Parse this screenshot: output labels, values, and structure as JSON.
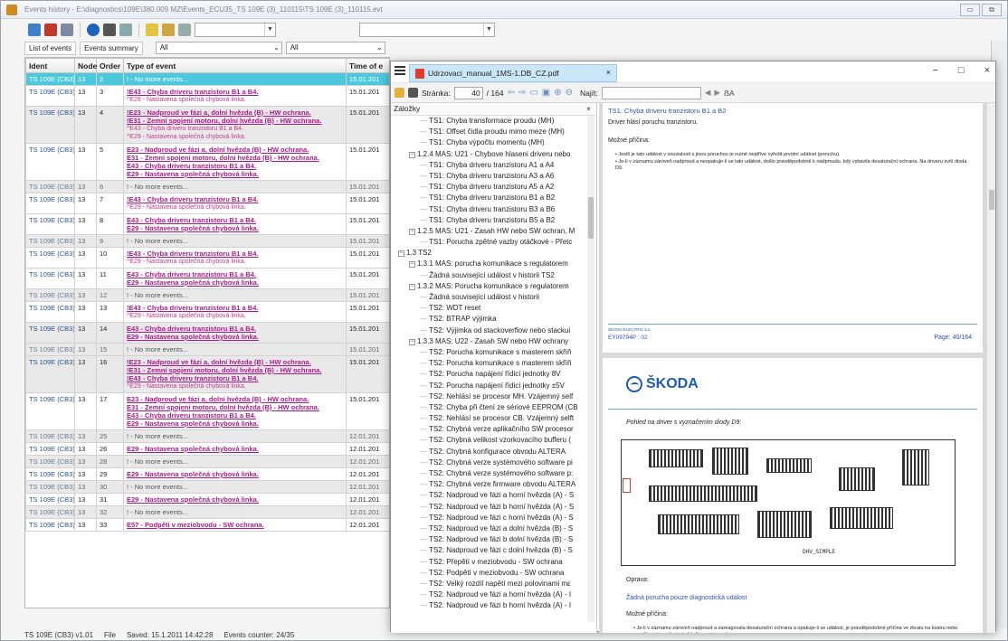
{
  "window": {
    "title": "Events history - E:\\diagnostics\\109E\\380.009 MZ\\Events_ECU35_TS 109E (3)_110115\\TS 109E (3)_110115.evt",
    "controls": [
      "▭",
      "⧉"
    ]
  },
  "toolbar": {
    "filter_value": "",
    "search_value": ""
  },
  "tabs": [
    "List of events",
    "Events summary"
  ],
  "filters": [
    "All",
    "All"
  ],
  "table": {
    "headers": [
      "Ident",
      "Node",
      "Order",
      "Type of event",
      "Time of e"
    ],
    "rows": [
      {
        "style": "sel",
        "ident": "TS 109E (CB3)",
        "node": "13",
        "order": "2",
        "lines": [
          "! - No more events..."
        ],
        "time": "15.01.201"
      },
      {
        "style": "pink",
        "ident": "TS 109E (CB3)",
        "node": "13",
        "order": "3",
        "lines": [
          "!E43 - Chyba driveru tranzistoru B1 a B4.",
          "^E29 - Nastavena společná chybová linka."
        ],
        "time": "15.01.201"
      },
      {
        "style": "mixed",
        "ident": "TS 109E (CB3)",
        "node": "13",
        "order": "4",
        "lines": [
          "!E23 - Nadproud ve fázi a, dolní hvězda (B) - HW ochrana.",
          "!E31 - Zemní spojení motoru, dolní hvězda (B) - HW ochrana.",
          "^E43 - Chyba driveru tranzistoru B1 a B4.",
          "^E29 - Nastavena společná chybová linka."
        ],
        "time": "15.01.201"
      },
      {
        "style": "pink",
        "ident": "TS 109E (CB3)",
        "node": "13",
        "order": "5",
        "lines": [
          "E23 - Nadproud ve fázi a, dolní hvězda (B) - HW ochrana.",
          "E31 - Zemní spojení motoru, dolní hvězda (B) - HW ochrana.",
          "E43 - Chyba driveru tranzistoru B1 a B4.",
          "E29 - Nastavena společná chybová linka."
        ],
        "time": "15.01.201"
      },
      {
        "style": "gray",
        "ident": "TS 109E (CB3)",
        "node": "13",
        "order": "6",
        "lines": [
          "! - No more events..."
        ],
        "time": "15.01.201"
      },
      {
        "style": "pink",
        "ident": "TS 109E (CB3)",
        "node": "13",
        "order": "7",
        "lines": [
          "!E43 - Chyba driveru tranzistoru B1 a B4.",
          "^E29 - Nastavena společná chybová linka."
        ],
        "time": "15.01.201"
      },
      {
        "style": "pink",
        "ident": "TS 109E (CB3)",
        "node": "13",
        "order": "8",
        "lines": [
          "E43 - Chyba driveru tranzistoru B1 a B4.",
          "E29 - Nastavena společná chybová linka."
        ],
        "time": "15.01.201"
      },
      {
        "style": "gray",
        "ident": "TS 109E (CB3)",
        "node": "13",
        "order": "9",
        "lines": [
          "! - No more events..."
        ],
        "time": "15.01.201"
      },
      {
        "style": "pink",
        "ident": "TS 109E (CB3)",
        "node": "13",
        "order": "10",
        "lines": [
          "!E43 - Chyba driveru tranzistoru B1 a B4.",
          "^E29 - Nastavena společná chybová linka."
        ],
        "time": "15.01.201"
      },
      {
        "style": "pink",
        "ident": "TS 109E (CB3)",
        "node": "13",
        "order": "11",
        "lines": [
          "E43 - Chyba driveru tranzistoru B1 a B4.",
          "E29 - Nastavena společná chybová linka."
        ],
        "time": "15.01.201"
      },
      {
        "style": "gray",
        "ident": "TS 109E (CB3)",
        "node": "13",
        "order": "12",
        "lines": [
          "! - No more events..."
        ],
        "time": "15.01.201"
      },
      {
        "style": "pink",
        "ident": "TS 109E (CB3)",
        "node": "13",
        "order": "13",
        "lines": [
          "!E43 - Chyba driveru tranzistoru B1 a B4.",
          "^E29 - Nastavena společná chybová linka."
        ],
        "time": "15.01.201"
      },
      {
        "style": "mixed",
        "ident": "TS 109E (CB3)",
        "node": "13",
        "order": "14",
        "lines": [
          "E43 - Chyba driveru tranzistoru B1 a B4.",
          "E29 - Nastavena společná chybová linka."
        ],
        "time": "15.01.201"
      },
      {
        "style": "gray",
        "ident": "TS 109E (CB3)",
        "node": "13",
        "order": "15",
        "lines": [
          "! - No more events..."
        ],
        "time": "15.01.201"
      },
      {
        "style": "mixed",
        "ident": "TS 109E (CB3)",
        "node": "13",
        "order": "16",
        "lines": [
          "!E23 - Nadproud ve fázi a, dolní hvězda (B) - HW ochrana.",
          "!E31 - Zemní spojení motoru, dolní hvězda (B) - HW ochrana.",
          "!E43 - Chyba driveru tranzistoru B1 a B4.",
          "^E29 - Nastavena společná chybová linka."
        ],
        "time": "15.01.201"
      },
      {
        "style": "pink",
        "ident": "TS 109E (CB3)",
        "node": "13",
        "order": "17",
        "lines": [
          "E23 - Nadproud ve fázi a, dolní hvězda (B) - HW ochrana.",
          "E31 - Zemní spojení motoru, dolní hvězda (B) - HW ochrana.",
          "E43 - Chyba driveru tranzistoru B1 a B4.",
          "E29 - Nastavena společná chybová linka."
        ],
        "time": "15.01.201"
      },
      {
        "style": "gray",
        "ident": "TS 109E (CB3)",
        "node": "13",
        "order": "25",
        "lines": [
          "! - No more events..."
        ],
        "time": "12.01.201"
      },
      {
        "style": "pink",
        "ident": "TS 109E (CB3)",
        "node": "13",
        "order": "26",
        "lines": [
          "E29 - Nastavena společná chybová linka."
        ],
        "time": "12.01.201"
      },
      {
        "style": "gray",
        "ident": "TS 109E (CB3)",
        "node": "13",
        "order": "28",
        "lines": [
          "! - No more events..."
        ],
        "time": "12.01.201"
      },
      {
        "style": "pink",
        "ident": "TS 109E (CB3)",
        "node": "13",
        "order": "29",
        "lines": [
          "E29 - Nastavena společná chybová linka."
        ],
        "time": "12.01.201"
      },
      {
        "style": "gray",
        "ident": "TS 109E (CB3)",
        "node": "13",
        "order": "30",
        "lines": [
          "! - No more events..."
        ],
        "time": "12.01.201"
      },
      {
        "style": "pink",
        "ident": "TS 109E (CB3)",
        "node": "13",
        "order": "31",
        "lines": [
          "E29 - Nastavena společná chybová linka."
        ],
        "time": "12.01.201"
      },
      {
        "style": "gray",
        "ident": "TS 109E (CB3)",
        "node": "13",
        "order": "32",
        "lines": [
          "! - No more events..."
        ],
        "time": "12.01.201"
      },
      {
        "style": "pink",
        "ident": "TS 109E (CB3)",
        "node": "13",
        "order": "33",
        "lines": [
          "E57 - Podpětí v meziobvodu - SW ochrana."
        ],
        "time": "12.01.201"
      }
    ]
  },
  "status": {
    "device": "TS 109E (CB3) v1.01",
    "file": "File",
    "saved": "Saved: 15.1.2011 14:42:28",
    "counter": "Events counter: 24/35"
  },
  "pdf": {
    "tab_title": "Udrzovaci_manual_1MS-1.DB_CZ.pdf",
    "close": "×",
    "window_controls": [
      "−",
      "□",
      "×"
    ],
    "page_label": "Stránka:",
    "page_current": "40",
    "page_total": "/ 164",
    "find_label": "Najít:",
    "find_value": "",
    "bookmarks_title": "Záložky",
    "bookmarks_close": "×",
    "bookmarks": [
      {
        "indent": 3,
        "text": "TS1: Chyba transformace proudu (MH)"
      },
      {
        "indent": 3,
        "text": "TS1: Offset čidla proudu mimo meze (MH)"
      },
      {
        "indent": 3,
        "text": "TS1: Chyba výpočtu momentu (MH)"
      },
      {
        "indent": 2,
        "exp": "−",
        "text": "1.2.4 MAS: U21 - Chybove hlaseni driveru nebo"
      },
      {
        "indent": 3,
        "text": "TS1: Chyba driveru tranzistoru A1 a A4"
      },
      {
        "indent": 3,
        "text": "TS1: Chyba driveru tranzistoru A3 a A6"
      },
      {
        "indent": 3,
        "text": "TS1: Chyba driveru tranzistoru A5 a A2"
      },
      {
        "indent": 3,
        "text": "TS1: Chyba driveru tranzistoru B1 a B2"
      },
      {
        "indent": 3,
        "text": "TS1: Chyba driveru tranzistoru B3 a B6"
      },
      {
        "indent": 3,
        "text": "TS1: Chyba driveru tranzistoru B5 a B2"
      },
      {
        "indent": 2,
        "exp": "−",
        "text": "1.2.5 MAS: U21 - Zasah HW nebo SW ochran, M"
      },
      {
        "indent": 3,
        "text": "TS1: Porucha zpětné vazby otáčkové - Přetc"
      },
      {
        "indent": 1,
        "exp": "−",
        "text": "1.3 TS2"
      },
      {
        "indent": 2,
        "exp": "−",
        "text": "1.3.1 MAS: porucha komunikace s regulatorem"
      },
      {
        "indent": 3,
        "text": "Žádná související událost v historii TS2"
      },
      {
        "indent": 2,
        "exp": "−",
        "text": "1.3.2 MAS: Porucha komunikace s regulatorem"
      },
      {
        "indent": 3,
        "text": "Žádná související událost v historii"
      },
      {
        "indent": 3,
        "text": "TS2: WDT reset"
      },
      {
        "indent": 3,
        "text": "TS2: BTRAP výjimka"
      },
      {
        "indent": 3,
        "text": "TS2: Výjimka od stackoverflow nebo stackui"
      },
      {
        "indent": 2,
        "exp": "−",
        "text": "1.3.3 MAS: U22 - Zasah SW nebo HW ochrany"
      },
      {
        "indent": 3,
        "text": "TS2: Porucha komunikace s masterem skříň"
      },
      {
        "indent": 3,
        "text": "TS2: Porucha komunikace s masterem skříň"
      },
      {
        "indent": 3,
        "text": "TS2: Porucha napájení řídicí jednotky 8V"
      },
      {
        "indent": 3,
        "text": "TS2: Porucha napájení řídicí jednotky ±5V"
      },
      {
        "indent": 3,
        "text": "TS2: Nehlásí se procesor MH. Vzájemný self"
      },
      {
        "indent": 3,
        "text": "TS2: Chyba při čtení ze sériové EEPROM (CB"
      },
      {
        "indent": 3,
        "text": "TS2: Nehlásí se procesor CB. Vzájemný selft"
      },
      {
        "indent": 3,
        "text": "TS2: Chybná verze aplikačního SW procesor"
      },
      {
        "indent": 3,
        "text": "TS2: Chybná velikost vzorkovacího bufferu ("
      },
      {
        "indent": 3,
        "text": "TS2: Chybná konfigurace obvodu ALTERA"
      },
      {
        "indent": 3,
        "text": "TS2: Chybná verze systémového software pi"
      },
      {
        "indent": 3,
        "text": "TS2: Chybná verze systémového software p:"
      },
      {
        "indent": 3,
        "text": "TS2: Chybná verze firmware obvodu ALTERA"
      },
      {
        "indent": 3,
        "text": "TS2: Nadproud ve fázi a horní hvězda (A) - S"
      },
      {
        "indent": 3,
        "text": "TS2: Nadproud ve fázi b horní hvězda (A) - S"
      },
      {
        "indent": 3,
        "text": "TS2: Nadproud ve fázi c horní hvězda (A) - S"
      },
      {
        "indent": 3,
        "text": "TS2: Nadproud ve fázi a dolní hvězda (B) - S"
      },
      {
        "indent": 3,
        "text": "TS2: Nadproud ve fázi b dolní hvězda (B) - S"
      },
      {
        "indent": 3,
        "text": "TS2: Nadproud ve fázi c dolní hvězda (B) - S"
      },
      {
        "indent": 3,
        "text": "TS2: Přepětí v meziobvodu - SW ochrana"
      },
      {
        "indent": 3,
        "text": "TS2: Podpětí v meziobvodu - SW ochrana"
      },
      {
        "indent": 3,
        "text": "TS2: Velký rozdíl napětí mezi polovinami mε"
      },
      {
        "indent": 3,
        "text": "TS2: Nadproud ve fázi a horní hvězda (A) - I"
      },
      {
        "indent": 3,
        "text": "TS2: Nadproud ve fázi b horní hvězda (A) - I"
      }
    ],
    "page1": {
      "heading": "TS1: Chyba driveru tranzistoru B1 a B2",
      "line1": "Driver hlásí poruchu tranzistoru.",
      "label_cause": "Možné příčina:",
      "bullet1": "Jestli je tato událost v souvislosti s jinou poruchou je nutné nejdříve vyřešit prvotní událost (poruchu).",
      "bullet2": "Je-li v záznamu zároveň nadproud a neopakuje-li se tato událost, došlo pravděpodobně k nadproudu, kdy vybavila desaturační ochrana. Na driveru svítí dioda D9.",
      "footer_company": "ŠKODA ELECTRIC a.s.",
      "footer_doc": "EY09794P : 02",
      "footer_page": "Page: 40/164"
    },
    "page2": {
      "logo": "ŠKODA",
      "caption": "Pohled na driver s vyznačením diody D9:",
      "board_label": "DHV_SIMPLE",
      "label_fix": "Oprava:",
      "fix_text": "Žádná porucha pouze diagnostická událost",
      "label_cause": "Možné příčina:",
      "bullet1": "Je-li v záznamu zároveň nadproud a zareagovala desaturační ochrana a opakuje-li se událost, je pravděpodobné příčina ve zkratu na kostru nebo mezifázovému zkratu trakčního motoru nebo v"
    }
  }
}
